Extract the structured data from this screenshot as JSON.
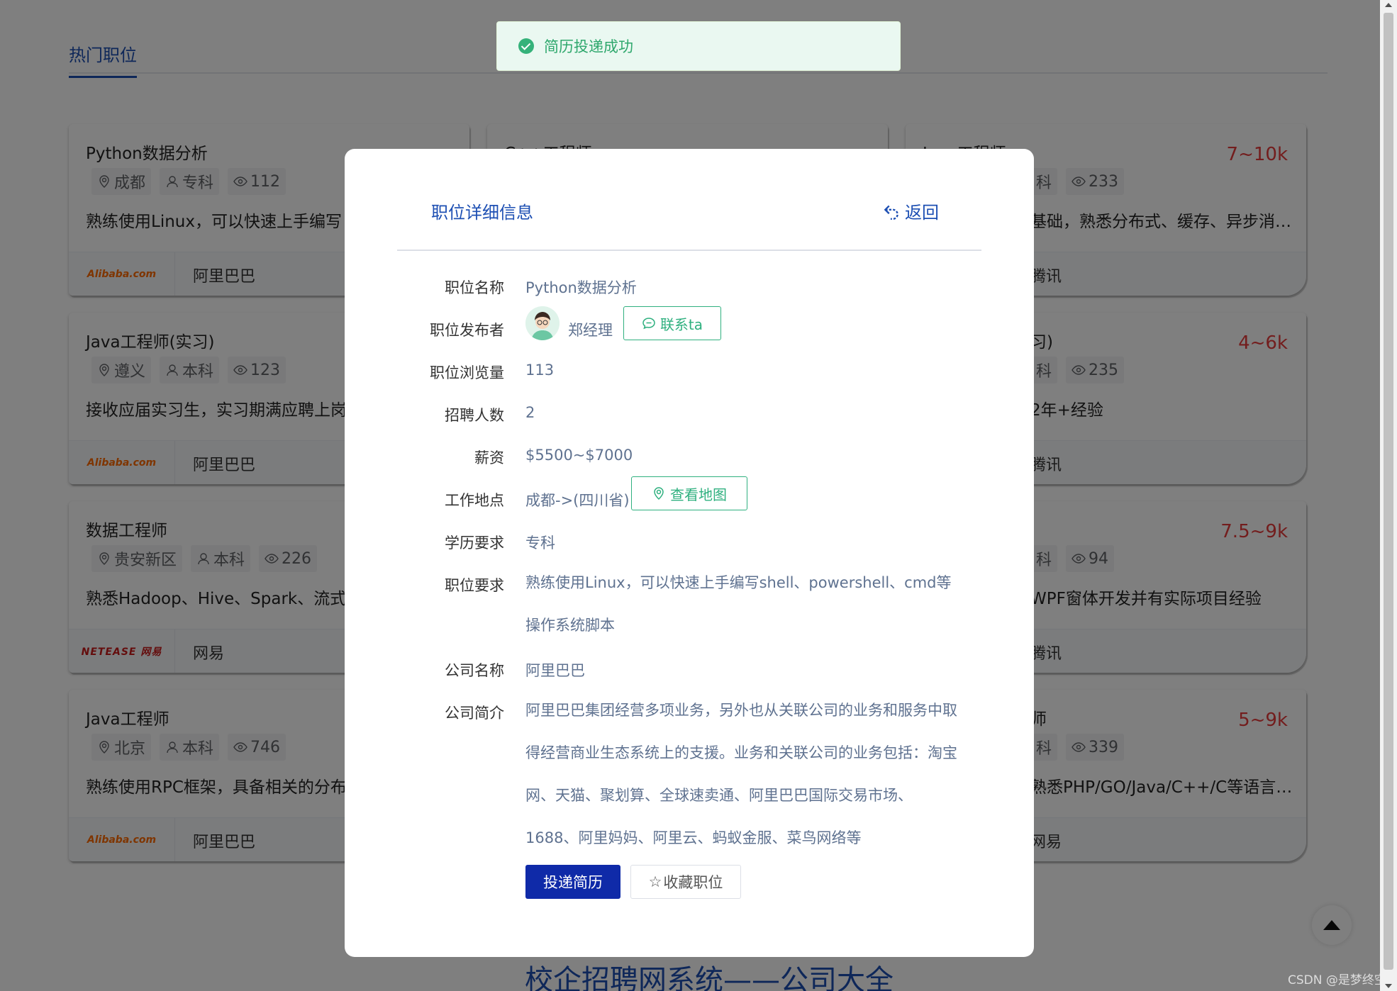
{
  "tabs": {
    "active": "热门职位"
  },
  "cards": [
    {
      "title": "Python数据分析",
      "salary": "",
      "city": "成都",
      "degree": "专科",
      "views": "112",
      "desc": "熟练使用Linux，可以快速上手编写",
      "logo": "Alibaba.com",
      "company": "阿里巴巴"
    },
    {
      "title": "C++工程师",
      "salary": "",
      "city": "",
      "degree": "",
      "views": "",
      "desc": "",
      "logo": "",
      "company": ""
    },
    {
      "title": "Java工程师",
      "salary": "7~10k",
      "city": "",
      "degree": "科",
      "views": "233",
      "desc": "基础，熟悉分布式、缓存、异步消…",
      "logo": "",
      "company": "腾讯"
    },
    {
      "title": "Java工程师(实习)",
      "salary": "",
      "city": "遵义",
      "degree": "本科",
      "views": "123",
      "desc": "接收应届实习生，实习期满应聘上岗",
      "logo": "Alibaba.com",
      "company": "阿里巴巴"
    },
    {
      "title": "习)",
      "salary": "4~6k",
      "city": "",
      "degree": "科",
      "views": "235",
      "desc": "2年+经验",
      "logo": "",
      "company": "腾讯"
    },
    {
      "title": "数据工程师",
      "salary": "",
      "city": "贵安新区",
      "degree": "本科",
      "views": "226",
      "desc": "熟悉Hadoop、Hive、Spark、流式",
      "logo": "NETEASE 网易",
      "company": "网易"
    },
    {
      "title": "",
      "salary": "7.5~9k",
      "city": "",
      "degree": "科",
      "views": "94",
      "desc": "WPF窗体开发并有实际项目经验",
      "logo": "",
      "company": "腾讯"
    },
    {
      "title": "Java工程师",
      "salary": "",
      "city": "北京",
      "degree": "本科",
      "views": "746",
      "desc": "熟练使用RPC框架，具备相关的分布式",
      "logo": "Alibaba.com",
      "company": "阿里巴巴"
    },
    {
      "title": "师",
      "salary": "5~9k",
      "city": "",
      "degree": "科",
      "views": "339",
      "desc": "熟悉PHP/GO/Java/C++/C等语言…",
      "logo": "",
      "company": "网易"
    }
  ],
  "footer_title": "校企招聘网系统——公司大全",
  "watermark": "CSDN @是梦终空",
  "toast": {
    "message": "简历投递成功",
    "color": "#2fa86d"
  },
  "dialog": {
    "title": "职位详细信息",
    "back": "返回",
    "fields": {
      "name_label": "职位名称",
      "name": "Python数据分析",
      "publisher_label": "职位发布者",
      "publisher": "郑经理",
      "contact": "联系ta",
      "views_label": "职位浏览量",
      "views": "113",
      "headcount_label": "招聘人数",
      "headcount": "2",
      "salary_label": "薪资",
      "salary": "$5500~$7000",
      "location_label": "工作地点",
      "location": "成都->(四川省)",
      "map": "查看地图",
      "education_label": "学历要求",
      "education": "专科",
      "requirement_label": "职位要求",
      "requirement": "熟练使用Linux，可以快速上手编写shell、powershell、cmd等操作系统脚本",
      "company_label": "公司名称",
      "company": "阿里巴巴",
      "intro_label": "公司简介",
      "intro": "阿里巴巴集团经营多项业务，另外也从关联公司的业务和服务中取得经营商业生态系统上的支援。业务和关联公司的业务包括：淘宝网、天猫、聚划算、全球速卖通、阿里巴巴国际交易市场、1688、阿里妈妈、阿里云、蚂蚁金服、菜鸟网络等"
    },
    "submit": "投递简历",
    "favorite": "收藏职位"
  },
  "colors": {
    "primary": "#1d4fb3",
    "salary": "#e63b3b",
    "success": "#2fb07f",
    "button": "#0f2aa8"
  }
}
